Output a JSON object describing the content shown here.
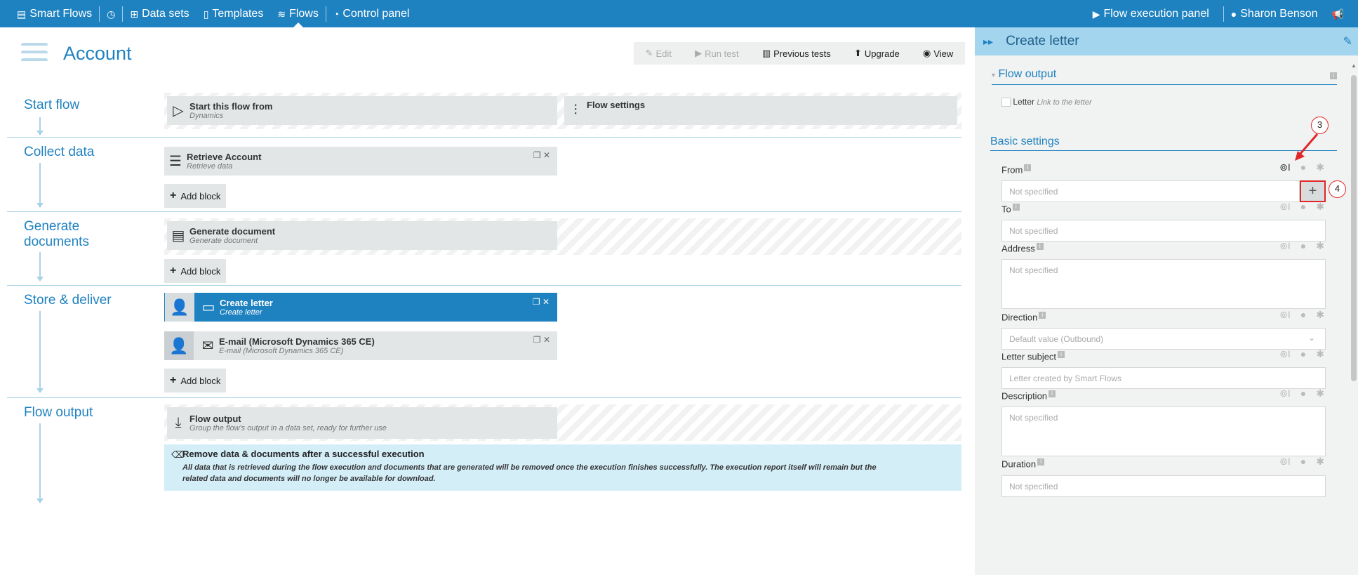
{
  "topbar": {
    "brand": "Smart Flows",
    "datasets": "Data sets",
    "templates": "Templates",
    "flows": "Flows",
    "control_panel": "Control panel",
    "flow_execution_panel": "Flow execution panel",
    "user": "Sharon Benson"
  },
  "page": {
    "title": "Account",
    "toolbar": {
      "edit": "Edit",
      "run_test": "Run test",
      "previous_tests": "Previous tests",
      "upgrade": "Upgrade",
      "view": "View"
    }
  },
  "sections": {
    "start": {
      "label": "Start flow",
      "start_block": {
        "title": "Start this flow from",
        "subtitle": "Dynamics"
      },
      "settings_block": {
        "title": "Flow settings"
      }
    },
    "collect": {
      "label": "Collect data",
      "block": {
        "title": "Retrieve Account",
        "subtitle": "Retrieve data"
      },
      "add": "Add block"
    },
    "generate": {
      "label": "Generate documents",
      "block": {
        "title": "Generate document",
        "subtitle": "Generate document"
      },
      "add": "Add block"
    },
    "store": {
      "label": "Store & deliver",
      "block1": {
        "title": "Create letter",
        "subtitle": "Create letter"
      },
      "block2": {
        "title": "E-mail (Microsoft Dynamics 365 CE)",
        "subtitle": "E-mail (Microsoft Dynamics 365 CE)"
      },
      "add": "Add block"
    },
    "output": {
      "label": "Flow output",
      "block": {
        "title": "Flow output",
        "subtitle": "Group the flow's output in a data set, ready for further use"
      },
      "info_title": "Remove data & documents after a successful execution",
      "info_text1": "All data that is retrieved during the flow execution and documents that are generated will be removed once the execution finishes successfully. The execution report itself will remain but the",
      "info_text2": "related data and documents will no longer be available for download."
    }
  },
  "panel": {
    "title": "Create letter",
    "flow_output": {
      "heading": "Flow output",
      "letter_label": "Letter",
      "letter_hint": "Link to the letter"
    },
    "basic_settings": "Basic settings",
    "fields": {
      "from": {
        "label": "From",
        "value": "Not specified"
      },
      "to": {
        "label": "To",
        "value": "Not specified"
      },
      "address": {
        "label": "Address",
        "value": "Not specified"
      },
      "direction": {
        "label": "Direction",
        "value": "Default value (Outbound)"
      },
      "subject": {
        "label": "Letter subject",
        "value": "Letter created by Smart Flows"
      },
      "description": {
        "label": "Description",
        "value": "Not specified"
      },
      "duration": {
        "label": "Duration",
        "value": "Not specified"
      }
    },
    "callouts": {
      "c3": "3",
      "c4": "4"
    }
  },
  "colors": {
    "brand": "#1f82c0",
    "panel_header": "#a4d5ee",
    "highlight": "#e0282a"
  }
}
